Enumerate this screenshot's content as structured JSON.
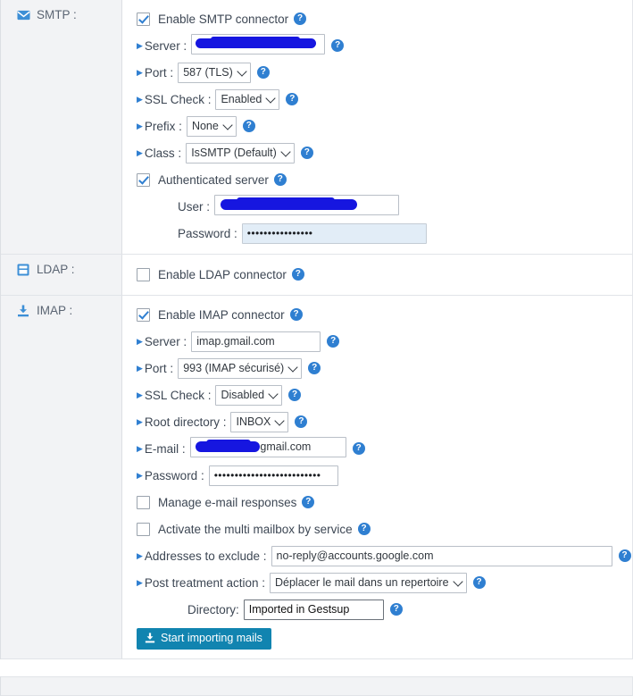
{
  "colors": {
    "accent": "#2f7fd1",
    "button": "#1184b0",
    "label_bg": "#f2f3f5",
    "redaction": "#1616e0",
    "autofill_bg": "#e2edf7"
  },
  "sections": {
    "smtp": {
      "label": "SMTP :",
      "icon": "envelope-icon",
      "enable": {
        "label": "Enable SMTP connector",
        "checked": true
      },
      "server": {
        "label": "Server :",
        "value": "",
        "redacted": true
      },
      "port": {
        "label": "Port :",
        "value": "587 (TLS)"
      },
      "ssl_check": {
        "label": "SSL Check :",
        "value": "Enabled"
      },
      "prefix": {
        "label": "Prefix :",
        "value": "None"
      },
      "class": {
        "label": "Class :",
        "value": "IsSMTP (Default)"
      },
      "authenticated": {
        "label": "Authenticated server",
        "checked": true
      },
      "user": {
        "label": "User :",
        "value": "",
        "redacted": true
      },
      "password": {
        "label": "Password :",
        "value": "••••••••••••••••"
      }
    },
    "ldap": {
      "label": "LDAP :",
      "icon": "database-icon",
      "enable": {
        "label": "Enable LDAP connector",
        "checked": false
      }
    },
    "imap": {
      "label": "IMAP :",
      "icon": "download-icon",
      "enable": {
        "label": "Enable IMAP connector",
        "checked": true
      },
      "server": {
        "label": "Server :",
        "value": "imap.gmail.com"
      },
      "port": {
        "label": "Port :",
        "value": "993 (IMAP sécurisé)"
      },
      "ssl_check": {
        "label": "SSL Check :",
        "value": "Disabled"
      },
      "root_directory": {
        "label": "Root directory :",
        "value": "INBOX"
      },
      "email": {
        "label": "E-mail :",
        "value": "@gmail.com",
        "redacted": true
      },
      "password": {
        "label": "Password :",
        "value": "••••••••••••••••••••••••••"
      },
      "manage_responses": {
        "label": "Manage e-mail responses",
        "checked": false
      },
      "multi_mailbox": {
        "label": "Activate the multi mailbox by service",
        "checked": false
      },
      "addresses_exclude": {
        "label": "Addresses to exclude :",
        "value": "no-reply@accounts.google.com"
      },
      "post_treatment": {
        "label": "Post treatment action :",
        "value": "Déplacer le mail dans un repertoire"
      },
      "directory": {
        "label": "Directory:",
        "value": "Imported in Gestsup"
      },
      "import_button": {
        "label": "Start importing mails",
        "icon": "download-icon"
      }
    }
  },
  "help_icon": "?"
}
